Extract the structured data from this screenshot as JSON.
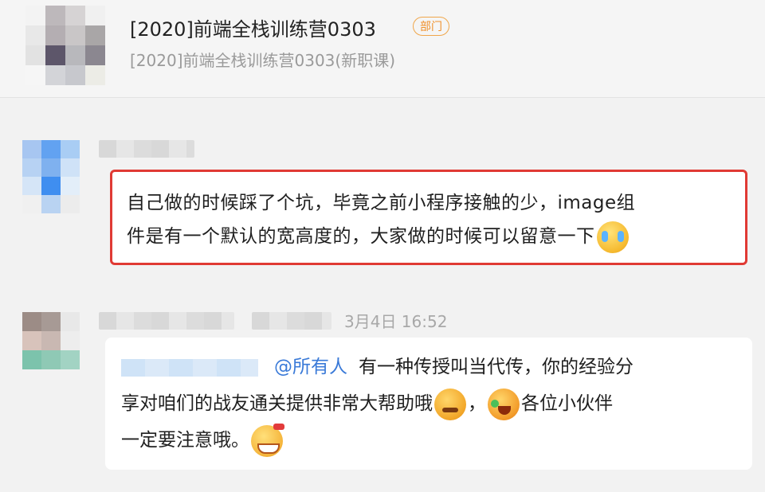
{
  "header": {
    "title": "[2020]前端全栈训练营0303",
    "badge": "部门",
    "subtitle": "[2020]前端全栈训练营0303(新职课)"
  },
  "messages": [
    {
      "text_line1": "自己做的时候踩了个坑，毕竟之前小程序接触的少，image组",
      "text_line2": "件是有一个默认的宽高度的，大家做的时候可以留意一下",
      "emoji": "crying-face-icon",
      "highlighted": true,
      "highlight_color": "#e03a34"
    },
    {
      "time": "3月4日 16:52",
      "mention": "@所有人",
      "text_part1": "有一种传授叫当代传，你的经验分",
      "text_part2": "享对咱们的战友通关提供非常大帮助哦",
      "text_part3": "，",
      "text_part4": "各位小伙伴",
      "text_part5": "一定要注意哦。",
      "emojis": [
        "thinking-face-icon",
        "laughing-face-icon",
        "grinning-face-icon"
      ]
    }
  ],
  "colors": {
    "mention": "#3a7ad8",
    "badge": "#f0902a",
    "background": "#f2f2f2"
  }
}
